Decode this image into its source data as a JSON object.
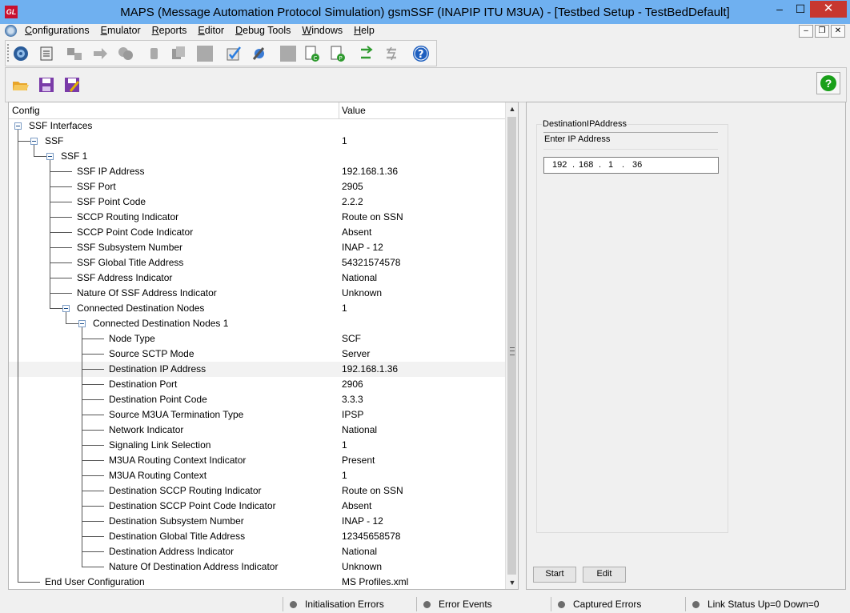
{
  "window": {
    "title": "MAPS (Message Automation Protocol Simulation) gsmSSF (INAPIP ITU M3UA) - [Testbed Setup - TestBedDefault]",
    "logo_text": "GL",
    "min_label": "–",
    "max_label": "☐",
    "close_label": "✕"
  },
  "menu": {
    "items": [
      "Configurations",
      "Emulator",
      "Reports",
      "Editor",
      "Debug Tools",
      "Windows",
      "Help"
    ]
  },
  "mdi_controls": {
    "minimize": "–",
    "restore": "❐",
    "close": "✕"
  },
  "toolbar": {
    "buttons": [
      "gear-icon",
      "script-icon",
      "network-icon",
      "arrow-icon",
      "relay-icon",
      "phone-icon",
      "copy-icon",
      "blank-icon",
      "edit-check-icon",
      "tools-icon",
      "square-icon",
      "callgen-icon",
      "profile-icon",
      "compile-icon",
      "decompile-icon",
      "help-icon"
    ]
  },
  "sub_toolbar": {
    "buttons": [
      "open-folder-icon",
      "save-icon",
      "save-as-icon"
    ],
    "help_label": "?"
  },
  "tree": {
    "header": {
      "config": "Config",
      "value": "Value"
    },
    "rows": [
      {
        "label": "SSF Interfaces",
        "value": "",
        "level": 0,
        "expander": true
      },
      {
        "label": "SSF",
        "value": "1",
        "level": 1,
        "expander": true
      },
      {
        "label": "SSF 1",
        "value": "",
        "level": 2,
        "expander": true
      },
      {
        "label": "SSF IP Address",
        "value": "192.168.1.36",
        "level": 3
      },
      {
        "label": "SSF Port",
        "value": "2905",
        "level": 3
      },
      {
        "label": "SSF Point Code",
        "value": "2.2.2",
        "level": 3
      },
      {
        "label": "SCCP Routing Indicator",
        "value": "Route on SSN",
        "level": 3
      },
      {
        "label": "SCCP Point Code Indicator",
        "value": "Absent",
        "level": 3
      },
      {
        "label": "SSF Subsystem Number",
        "value": "INAP - 12",
        "level": 3
      },
      {
        "label": "SSF Global Title Address",
        "value": "54321574578",
        "level": 3
      },
      {
        "label": "SSF Address Indicator",
        "value": "National",
        "level": 3
      },
      {
        "label": "Nature Of SSF Address Indicator",
        "value": "Unknown",
        "level": 3
      },
      {
        "label": "Connected Destination Nodes",
        "value": "1",
        "level": 3,
        "expander": true
      },
      {
        "label": "Connected Destination Nodes 1",
        "value": "",
        "level": 4,
        "expander": true
      },
      {
        "label": "Node Type",
        "value": "SCF",
        "level": 5
      },
      {
        "label": "Source SCTP Mode",
        "value": "Server",
        "level": 5
      },
      {
        "label": "Destination IP Address",
        "value": "192.168.1.36",
        "level": 5,
        "selected": true
      },
      {
        "label": "Destination Port",
        "value": "2906",
        "level": 5
      },
      {
        "label": "Destination Point Code",
        "value": "3.3.3",
        "level": 5
      },
      {
        "label": "Source M3UA Termination Type",
        "value": "IPSP",
        "level": 5
      },
      {
        "label": "Network Indicator",
        "value": "National",
        "level": 5
      },
      {
        "label": "Signaling Link Selection",
        "value": "1",
        "level": 5
      },
      {
        "label": "M3UA Routing Context Indicator",
        "value": "Present",
        "level": 5
      },
      {
        "label": "M3UA Routing Context",
        "value": "1",
        "level": 5
      },
      {
        "label": "Destination SCCP Routing Indicator",
        "value": "Route on SSN",
        "level": 5
      },
      {
        "label": "Destination SCCP Point Code Indicator",
        "value": "Absent",
        "level": 5
      },
      {
        "label": "Destination Subsystem Number",
        "value": "INAP - 12",
        "level": 5
      },
      {
        "label": "Destination Global Title Address",
        "value": "12345658578",
        "level": 5
      },
      {
        "label": "Destination Address Indicator",
        "value": "National",
        "level": 5
      },
      {
        "label": "Nature Of Destination Address Indicator",
        "value": "Unknown",
        "level": 5
      },
      {
        "label": "End User Configuration",
        "value": "MS Profiles.xml",
        "level": 1
      }
    ]
  },
  "editor": {
    "group_title": "DestinationIPAddress",
    "prompt": "Enter IP Address",
    "ip_octets": [
      "192",
      "168",
      "1",
      "36"
    ],
    "start_label": "Start",
    "edit_label": "Edit"
  },
  "status": {
    "items": [
      "Initialisation Errors",
      "Error Events",
      "Captured Errors",
      "Link Status Up=0 Down=0"
    ]
  }
}
